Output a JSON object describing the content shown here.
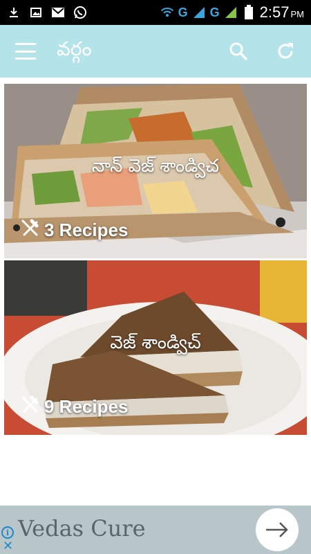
{
  "status_bar": {
    "network_1": "G",
    "network_2": "G",
    "time": "2:57",
    "ampm": "PM",
    "icons": [
      "download-icon",
      "image-icon",
      "gmail-icon",
      "whatsapp-icon",
      "wifi-hotspot-icon",
      "signal-icon",
      "battery-icon"
    ]
  },
  "app_bar": {
    "title": "వర్గం",
    "icons": [
      "menu-icon",
      "search-icon",
      "refresh-icon"
    ],
    "background": "#b4e3ea"
  },
  "categories": [
    {
      "title": "నాన్ వెజ్ శాండ్విచ",
      "count": "3 Recipes",
      "icon": "fork-knife-icon"
    },
    {
      "title": "వెజ్ శాండ్విచ్",
      "count": "9 Recipes",
      "icon": "fork-knife-icon"
    }
  ],
  "ad": {
    "text": "Vedas Cure",
    "info_glyph": "i",
    "close_glyph": "✕",
    "arrow_icon": "arrow-right-icon"
  }
}
